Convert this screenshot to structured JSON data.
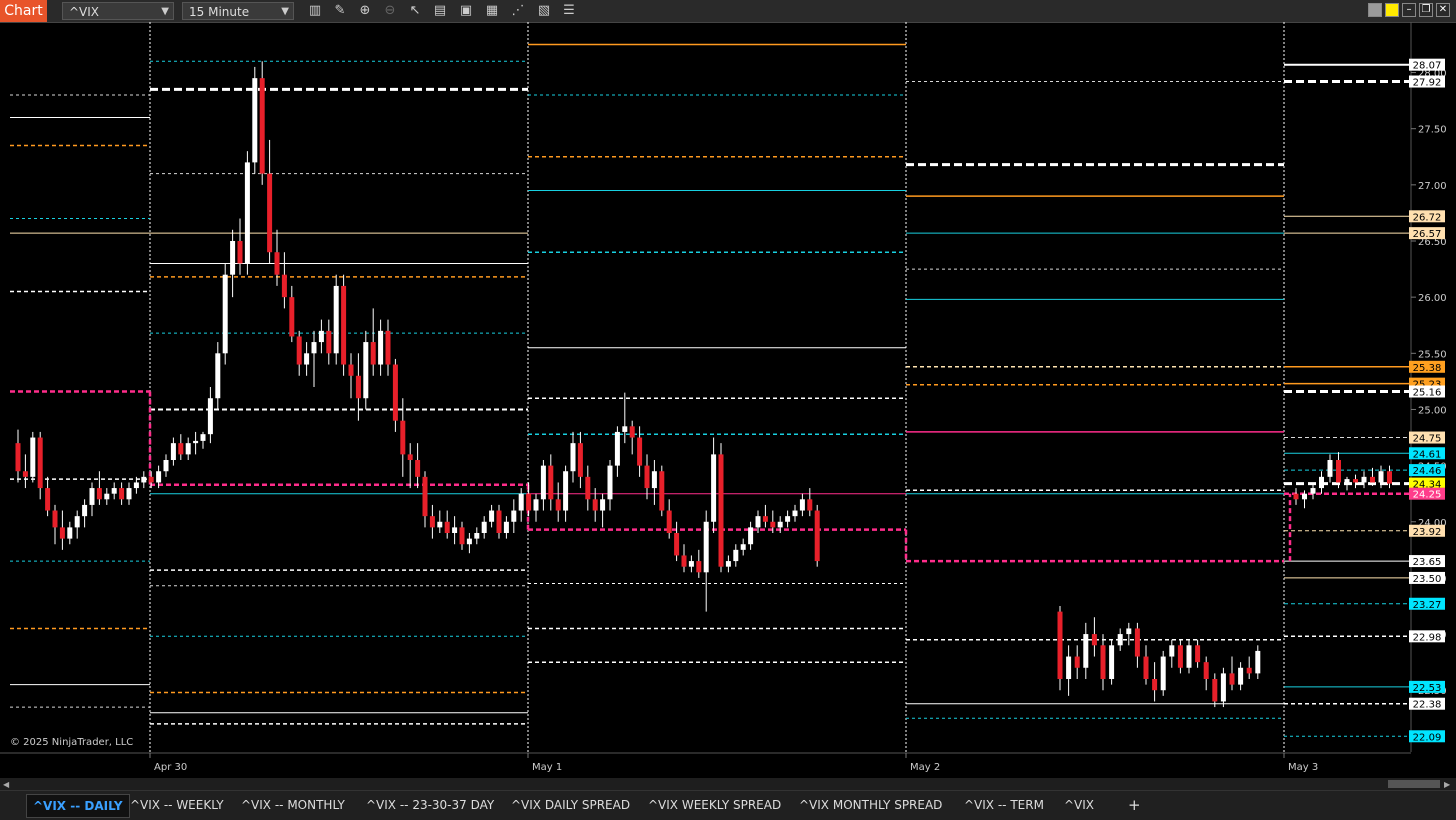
{
  "toolbar": {
    "title": "Chart",
    "instrument": "^VIX",
    "interval": "15 Minute",
    "tools": [
      "bars-icon",
      "pencil-icon",
      "zoom-in-icon",
      "zoom-out-icon",
      "cursor-icon",
      "properties-icon",
      "data-box-icon",
      "templates-icon",
      "indicators-icon",
      "strategies-icon",
      "list-icon"
    ],
    "window_buttons": [
      "theme-gray-icon",
      "theme-yellow-icon",
      "minimize-icon",
      "restore-icon",
      "maximize-icon",
      "close-icon"
    ]
  },
  "copyright": "© 2025 NinjaTrader, LLC",
  "tabs": [
    {
      "label": "^VIX -- DAILY",
      "active": true
    },
    {
      "label": "^VIX -- WEEKLY",
      "active": false
    },
    {
      "label": "^VIX -- MONTHLY",
      "active": false
    },
    {
      "label": "^VIX -- 23-30-37 DAY",
      "active": false
    },
    {
      "label": "^VIX DAILY SPREAD",
      "active": false
    },
    {
      "label": "^VIX WEEKLY SPREAD",
      "active": false
    },
    {
      "label": "^VIX MONTHLY SPREAD",
      "active": false
    },
    {
      "label": "^VIX -- TERM",
      "active": false
    },
    {
      "label": "^VIX",
      "active": false
    }
  ],
  "add_tab": "+",
  "chart_data": {
    "type": "candlestick",
    "x_labels": [
      "Apr 30",
      "May 1",
      "May 2",
      "May 3"
    ],
    "y_ticks": [
      "28.00",
      "27.50",
      "27.00",
      "26.50",
      "26.00",
      "25.50",
      "25.00",
      "24.50",
      "24.00",
      "23.50",
      "23.00",
      "22.50"
    ],
    "ylim": [
      21.95,
      28.45
    ],
    "price_tags": [
      {
        "value": "28.07",
        "bg": "#ffffff",
        "fg": "#000000"
      },
      {
        "value": "27.92",
        "bg": "#ffffff",
        "fg": "#000000"
      },
      {
        "value": "26.72",
        "bg": "#ffe0b0",
        "fg": "#000000"
      },
      {
        "value": "26.57",
        "bg": "#ffe0b0",
        "fg": "#000000"
      },
      {
        "value": "25.38",
        "bg": "#ffa020",
        "fg": "#000000"
      },
      {
        "value": "25.23",
        "bg": "#ffa020",
        "fg": "#000000"
      },
      {
        "value": "25.16",
        "bg": "#ffffff",
        "fg": "#000000"
      },
      {
        "value": "24.75",
        "bg": "#ffe0b0",
        "fg": "#000000"
      },
      {
        "value": "24.61",
        "bg": "#00e5ff",
        "fg": "#000000"
      },
      {
        "value": "24.46",
        "bg": "#00e5ff",
        "fg": "#000000"
      },
      {
        "value": "24.34",
        "bg": "#ffff00",
        "fg": "#000000"
      },
      {
        "value": "24.25",
        "bg": "#ff3d8b",
        "fg": "#ffffff"
      },
      {
        "value": "23.92",
        "bg": "#ffe0b0",
        "fg": "#000000"
      },
      {
        "value": "23.65",
        "bg": "#ffffff",
        "fg": "#000000"
      },
      {
        "value": "23.50",
        "bg": "#ffffff",
        "fg": "#000000"
      },
      {
        "value": "23.27",
        "bg": "#00e5ff",
        "fg": "#000000"
      },
      {
        "value": "22.98",
        "bg": "#ffffff",
        "fg": "#000000"
      },
      {
        "value": "22.53",
        "bg": "#00e5ff",
        "fg": "#000000"
      },
      {
        "value": "22.38",
        "bg": "#ffffff",
        "fg": "#000000"
      },
      {
        "value": "22.09",
        "bg": "#00e5ff",
        "fg": "#000000"
      }
    ],
    "candles_ohlc": [
      [
        24.7,
        24.82,
        24.35,
        24.45
      ],
      [
        24.45,
        24.6,
        24.3,
        24.4
      ],
      [
        24.4,
        24.8,
        24.35,
        24.75
      ],
      [
        24.75,
        24.8,
        24.2,
        24.3
      ],
      [
        24.3,
        24.4,
        24.05,
        24.1
      ],
      [
        24.1,
        24.15,
        23.8,
        23.95
      ],
      [
        23.95,
        24.1,
        23.75,
        23.85
      ],
      [
        23.85,
        24.0,
        23.8,
        23.95
      ],
      [
        23.95,
        24.1,
        23.85,
        24.05
      ],
      [
        24.05,
        24.2,
        23.95,
        24.15
      ],
      [
        24.15,
        24.35,
        24.05,
        24.3
      ],
      [
        24.3,
        24.45,
        24.15,
        24.2
      ],
      [
        24.2,
        24.3,
        24.15,
        24.25
      ],
      [
        24.25,
        24.35,
        24.2,
        24.3
      ],
      [
        24.3,
        24.35,
        24.15,
        24.2
      ],
      [
        24.2,
        24.35,
        24.15,
        24.3
      ],
      [
        24.3,
        24.4,
        24.25,
        24.35
      ],
      [
        24.35,
        24.45,
        24.3,
        24.4
      ],
      [
        24.4,
        24.45,
        24.3,
        24.35
      ],
      [
        24.35,
        24.5,
        24.3,
        24.45
      ],
      [
        24.45,
        24.6,
        24.4,
        24.55
      ],
      [
        24.55,
        24.75,
        24.5,
        24.7
      ],
      [
        24.7,
        24.78,
        24.55,
        24.6
      ],
      [
        24.6,
        24.75,
        24.55,
        24.7
      ],
      [
        24.7,
        24.8,
        24.6,
        24.72
      ],
      [
        24.72,
        24.8,
        24.65,
        24.78
      ],
      [
        24.78,
        25.2,
        24.7,
        25.1
      ],
      [
        25.1,
        25.6,
        25.0,
        25.5
      ],
      [
        25.5,
        26.3,
        25.4,
        26.2
      ],
      [
        26.2,
        26.6,
        26.0,
        26.5
      ],
      [
        26.5,
        26.7,
        26.2,
        26.3
      ],
      [
        26.3,
        27.3,
        26.2,
        27.2
      ],
      [
        27.2,
        28.05,
        27.1,
        27.95
      ],
      [
        27.95,
        28.1,
        27.0,
        27.1
      ],
      [
        27.1,
        27.4,
        26.3,
        26.4
      ],
      [
        26.4,
        26.6,
        26.1,
        26.2
      ],
      [
        26.2,
        26.4,
        25.9,
        26.0
      ],
      [
        26.0,
        26.1,
        25.6,
        25.65
      ],
      [
        25.65,
        25.7,
        25.3,
        25.4
      ],
      [
        25.4,
        25.6,
        25.3,
        25.5
      ],
      [
        25.5,
        25.7,
        25.2,
        25.6
      ],
      [
        25.6,
        25.8,
        25.5,
        25.7
      ],
      [
        25.7,
        25.8,
        25.4,
        25.5
      ],
      [
        25.5,
        26.2,
        25.4,
        26.1
      ],
      [
        26.1,
        26.2,
        25.3,
        25.4
      ],
      [
        25.4,
        25.5,
        25.1,
        25.3
      ],
      [
        25.3,
        25.5,
        24.9,
        25.1
      ],
      [
        25.1,
        25.7,
        25.0,
        25.6
      ],
      [
        25.6,
        25.9,
        25.3,
        25.4
      ],
      [
        25.4,
        25.8,
        25.3,
        25.7
      ],
      [
        25.7,
        25.8,
        25.3,
        25.4
      ],
      [
        25.4,
        25.45,
        24.8,
        24.9
      ],
      [
        24.9,
        25.1,
        24.4,
        24.6
      ],
      [
        24.6,
        24.7,
        24.3,
        24.55
      ]
    ]
  }
}
